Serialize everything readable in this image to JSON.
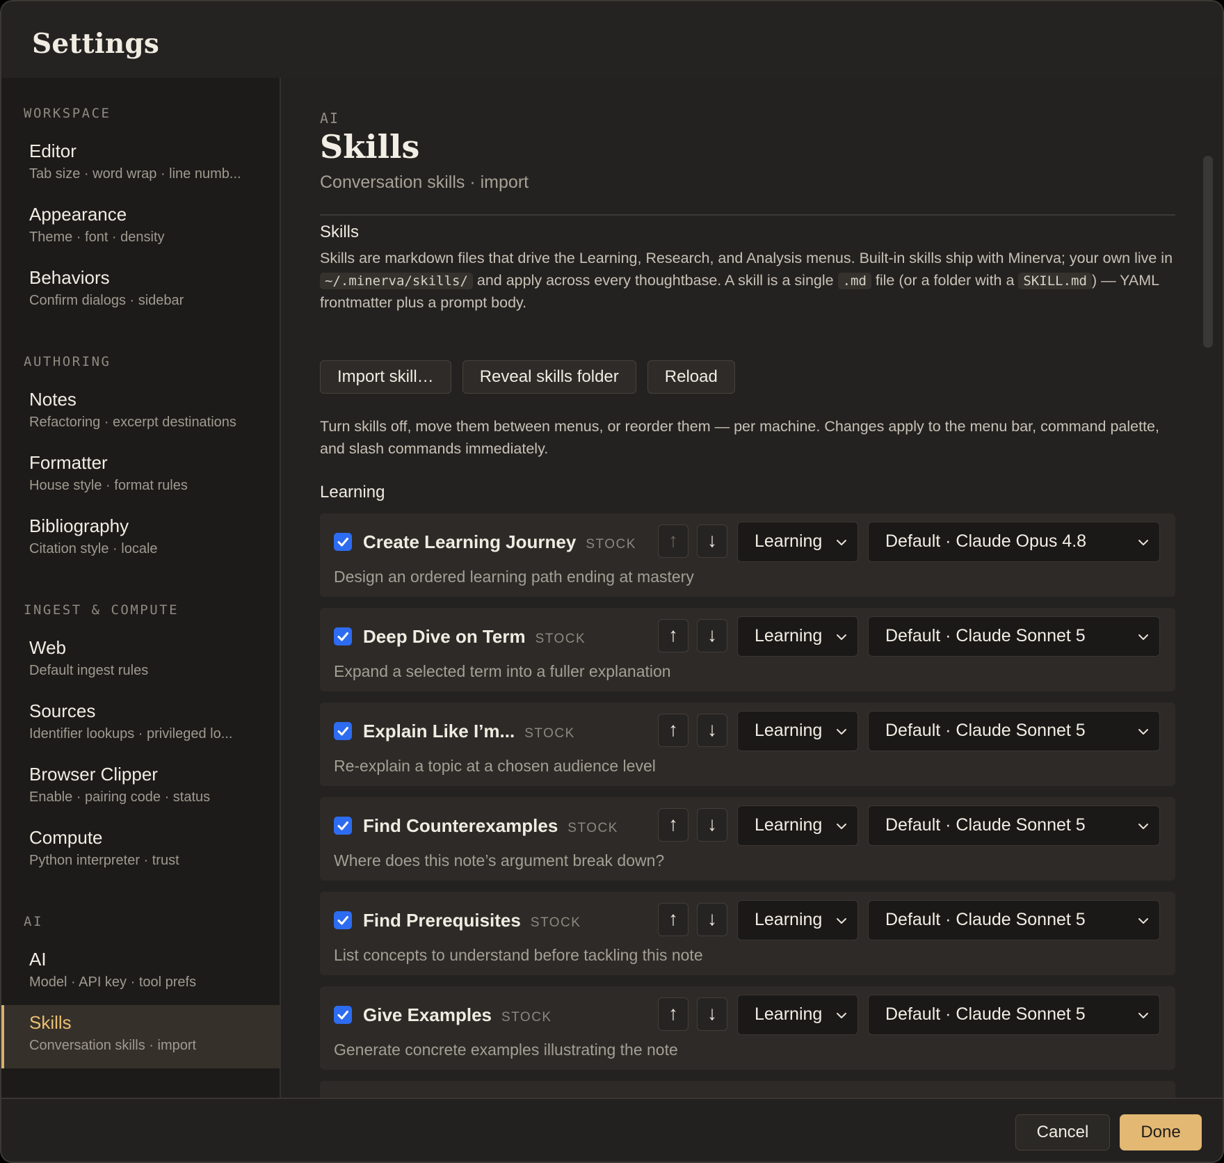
{
  "window": {
    "title": "Settings"
  },
  "sidebar": {
    "sections": [
      {
        "label": "WORKSPACE",
        "items": [
          {
            "title": "Editor",
            "subtitle": "Tab size · word wrap · line numb..."
          },
          {
            "title": "Appearance",
            "subtitle": "Theme · font · density"
          },
          {
            "title": "Behaviors",
            "subtitle": "Confirm dialogs · sidebar"
          }
        ]
      },
      {
        "label": "AUTHORING",
        "items": [
          {
            "title": "Notes",
            "subtitle": "Refactoring · excerpt destinations"
          },
          {
            "title": "Formatter",
            "subtitle": "House style · format rules"
          },
          {
            "title": "Bibliography",
            "subtitle": "Citation style · locale"
          }
        ]
      },
      {
        "label": "INGEST & COMPUTE",
        "items": [
          {
            "title": "Web",
            "subtitle": "Default ingest rules"
          },
          {
            "title": "Sources",
            "subtitle": "Identifier lookups · privileged lo..."
          },
          {
            "title": "Browser Clipper",
            "subtitle": "Enable · pairing code · status"
          },
          {
            "title": "Compute",
            "subtitle": "Python interpreter · trust"
          }
        ]
      },
      {
        "label": "AI",
        "items": [
          {
            "title": "AI",
            "subtitle": "Model · API key · tool prefs"
          },
          {
            "title": "Skills",
            "subtitle": "Conversation skills · import",
            "active": true
          }
        ]
      }
    ]
  },
  "main": {
    "breadcrumb": "AI",
    "title": "Skills",
    "subtitle": "Conversation skills · import",
    "skills_section": {
      "heading": "Skills",
      "desc_part1": "Skills are markdown files that drive the Learning, Research, and Analysis menus. Built-in skills ship with Minerva; your own live in ",
      "desc_code1": "~/.minerva/skills/",
      "desc_part2": " and apply across every thoughtbase. A skill is a single ",
      "desc_code2": ".md",
      "desc_part3": " file (or a folder with a ",
      "desc_code3": "SKILL.md",
      "desc_part4": ") — YAML frontmatter plus a prompt body."
    },
    "buttons": {
      "import": "Import skill…",
      "reveal": "Reveal skills folder",
      "reload": "Reload"
    },
    "info": "Turn skills off, move them between menus, or reorder them — per machine. Changes apply to the menu bar, command palette, and slash commands immediately.",
    "group_heading": "Learning",
    "skills": [
      {
        "name": "Create Learning Journey",
        "tag": "STOCK",
        "menu": "Learning",
        "model": "Default · Claude Opus 4.8",
        "desc": "Design an ordered learning path ending at mastery",
        "enabled": true
      },
      {
        "name": "Deep Dive on Term",
        "tag": "STOCK",
        "menu": "Learning",
        "model": "Default · Claude Sonnet 5",
        "desc": "Expand a selected term into a fuller explanation",
        "enabled": true
      },
      {
        "name": "Explain Like I’m...",
        "tag": "STOCK",
        "menu": "Learning",
        "model": "Default · Claude Sonnet 5",
        "desc": "Re-explain a topic at a chosen audience level",
        "enabled": true
      },
      {
        "name": "Find Counterexamples",
        "tag": "STOCK",
        "menu": "Learning",
        "model": "Default · Claude Sonnet 5",
        "desc": "Where does this note’s argument break down?",
        "enabled": true
      },
      {
        "name": "Find Prerequisites",
        "tag": "STOCK",
        "menu": "Learning",
        "model": "Default · Claude Sonnet 5",
        "desc": "List concepts to understand before tackling this note",
        "enabled": true
      },
      {
        "name": "Give Examples",
        "tag": "STOCK",
        "menu": "Learning",
        "model": "Default · Claude Sonnet 5",
        "desc": "Generate concrete examples illustrating the note",
        "enabled": true
      }
    ],
    "arrows": {
      "up": "↑",
      "down": "↓"
    }
  },
  "footer": {
    "cancel": "Cancel",
    "done": "Done"
  },
  "colors": {
    "accent": "#e2b872",
    "checkbox": "#2d6cf0",
    "background": "#242220",
    "sidebar": "#1c1b19"
  }
}
